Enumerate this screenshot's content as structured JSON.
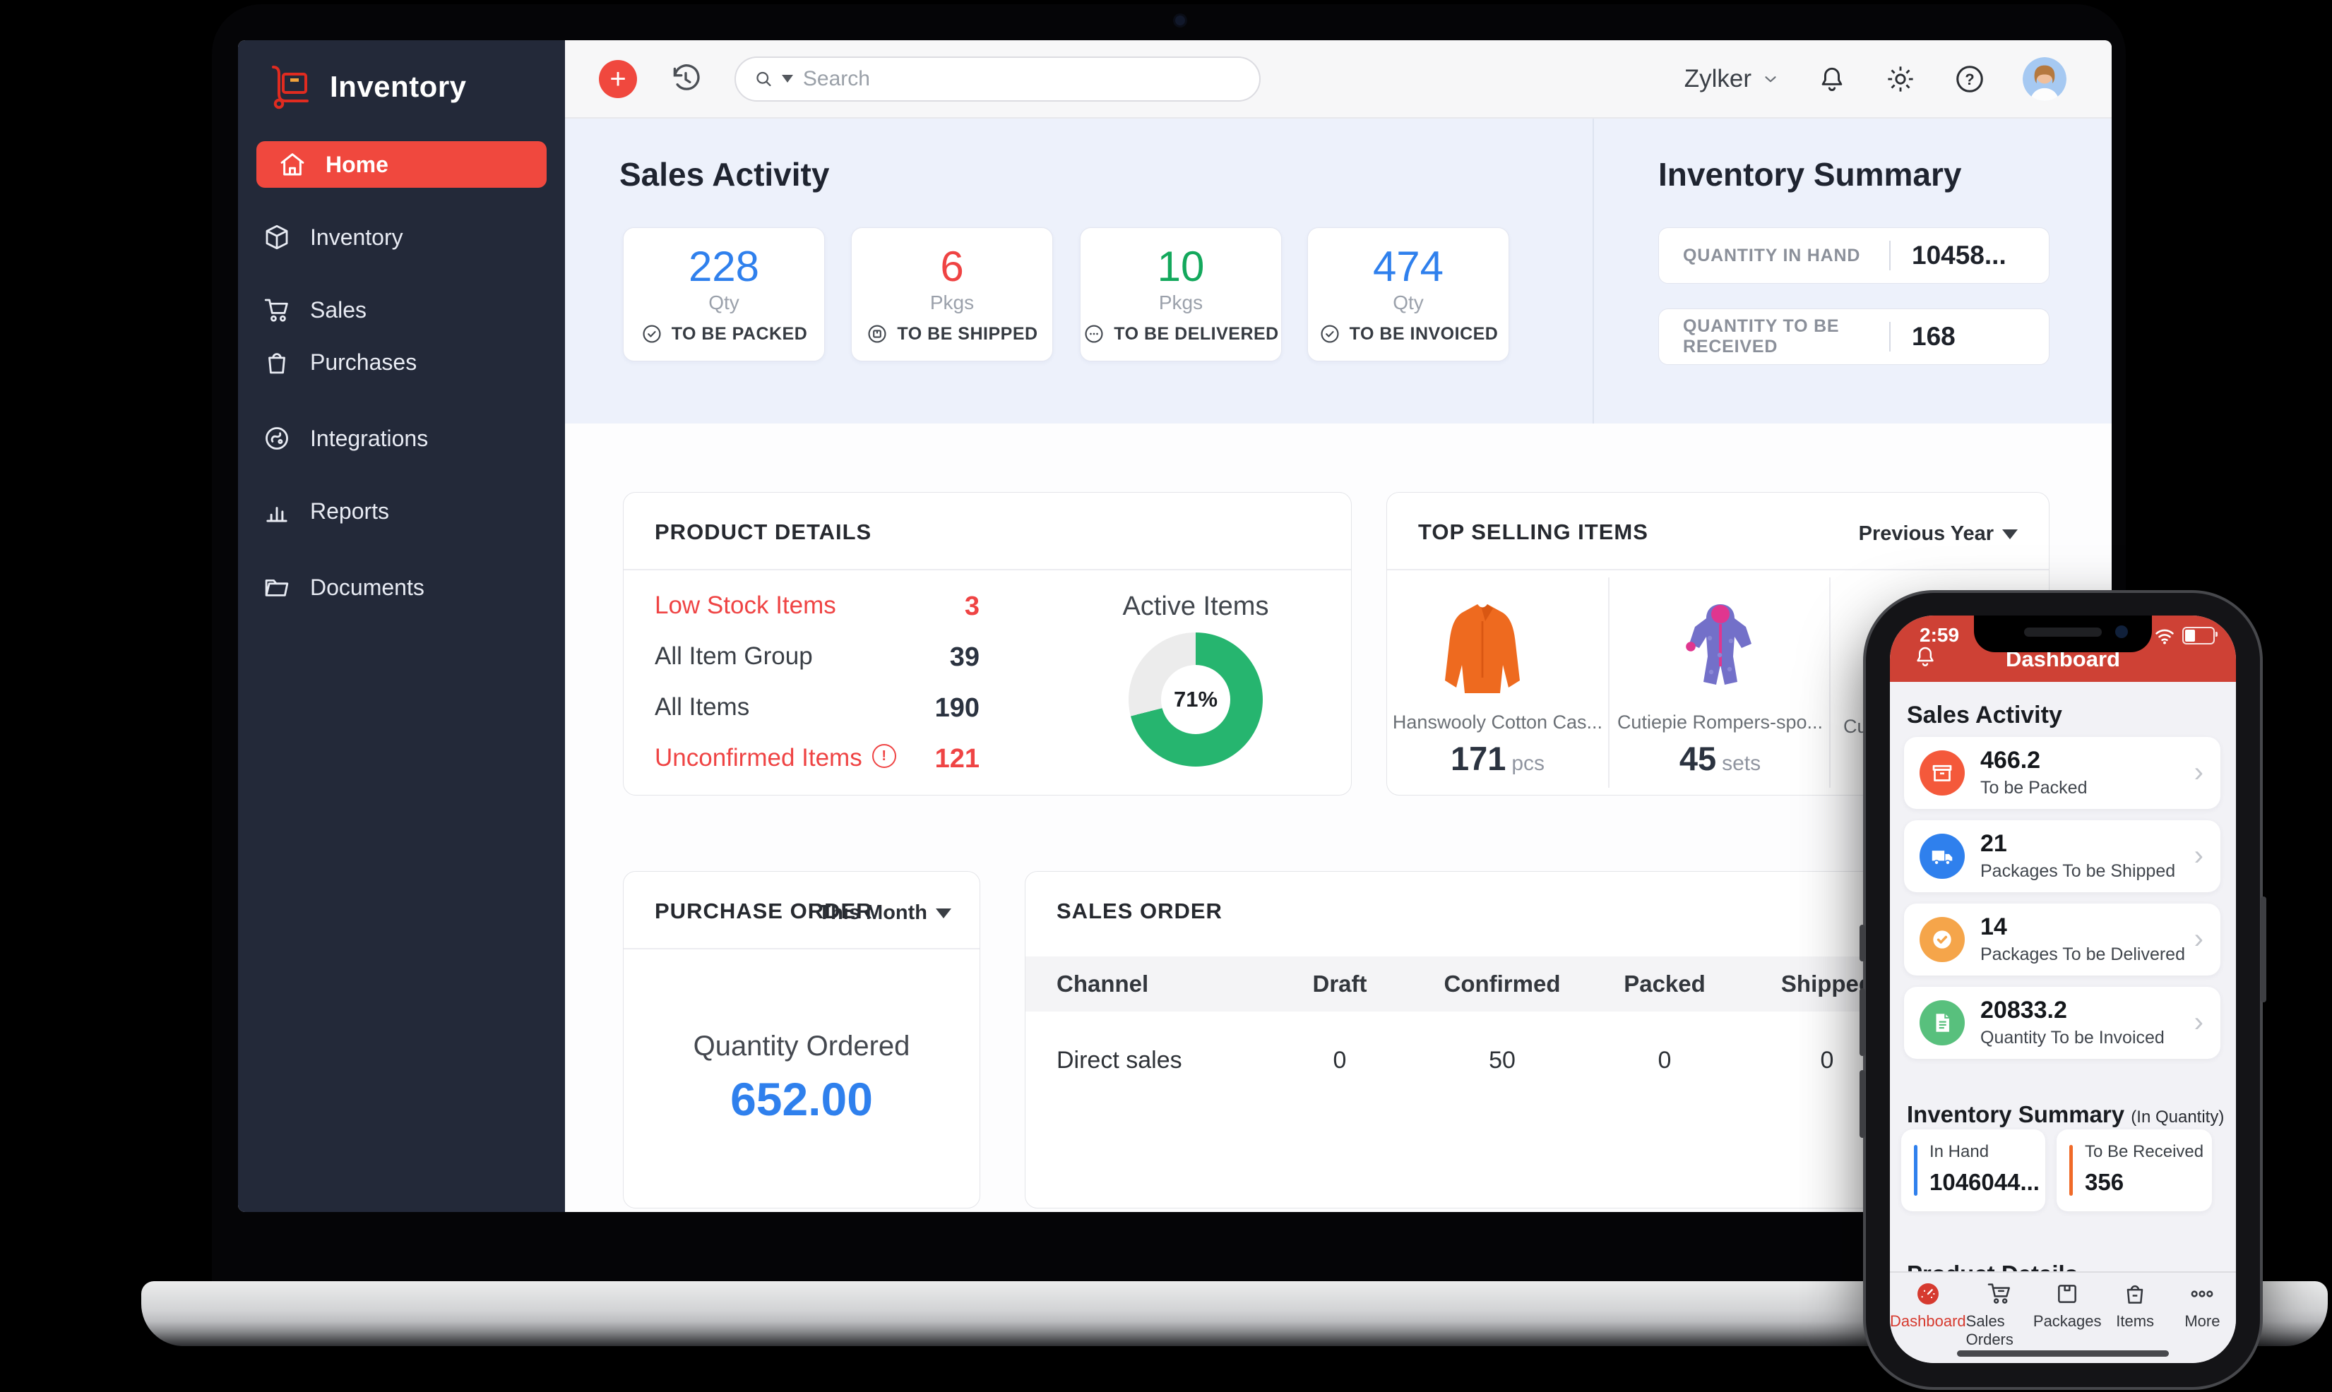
{
  "sidebar": {
    "app_title": "Inventory",
    "items": [
      {
        "label": "Home",
        "active": true,
        "has_submenu": false
      },
      {
        "label": "Inventory",
        "has_submenu": true
      },
      {
        "label": "Sales",
        "has_submenu": true
      },
      {
        "label": "Purchases",
        "has_submenu": true
      },
      {
        "label": "Integrations",
        "has_submenu": false
      },
      {
        "label": "Reports",
        "has_submenu": false
      },
      {
        "label": "Documents",
        "has_submenu": false
      }
    ],
    "bg_color": "#232939",
    "active_color": "#f0483e"
  },
  "topbar": {
    "search_placeholder": "Search",
    "org_name": "Zylker"
  },
  "hero": {
    "title": "Sales Activity",
    "cards": [
      {
        "value": "228",
        "unit": "Qty",
        "label": "TO BE PACKED",
        "color": "#2f80ed"
      },
      {
        "value": "6",
        "unit": "Pkgs",
        "label": "TO BE SHIPPED",
        "color": "#ef4343"
      },
      {
        "value": "10",
        "unit": "Pkgs",
        "label": "TO BE DELIVERED",
        "color": "#13a85c"
      },
      {
        "value": "474",
        "unit": "Qty",
        "label": "TO BE INVOICED",
        "color": "#2f80ed"
      }
    ],
    "summary": {
      "title": "Inventory Summary",
      "rows": [
        {
          "label": "QUANTITY IN HAND",
          "value": "10458..."
        },
        {
          "label": "QUANTITY TO BE RECEIVED",
          "value": "168"
        }
      ]
    }
  },
  "product_details": {
    "title": "PRODUCT DETAILS",
    "rows": [
      {
        "label": "Low Stock Items",
        "value": "3"
      },
      {
        "label": "All Item Group",
        "value": "39"
      },
      {
        "label": "All Items",
        "value": "190"
      },
      {
        "label": "Unconfirmed Items",
        "value": "121"
      }
    ],
    "donut": {
      "label": "Active Items",
      "percent": 71,
      "text": "71%",
      "color": "#26b56f",
      "track": "#ececec"
    }
  },
  "top_selling": {
    "title": "TOP SELLING ITEMS",
    "filter": "Previous Year",
    "items": [
      {
        "name": "Hanswooly Cotton Cas...",
        "qty": "171",
        "unit": "pcs"
      },
      {
        "name": "Cutiepie Rompers-spo...",
        "qty": "45",
        "unit": "sets"
      },
      {
        "name": "Cuti"
      }
    ]
  },
  "purchase_order": {
    "title": "PURCHASE ORDER",
    "filter": "This Month",
    "metric_label": "Quantity Ordered",
    "metric_value": "652.00",
    "value_color": "#2f80ed"
  },
  "sales_order": {
    "title": "SALES ORDER",
    "columns": [
      "Channel",
      "Draft",
      "Confirmed",
      "Packed",
      "Shipped"
    ],
    "rows": [
      {
        "channel": "Direct sales",
        "draft": "0",
        "confirmed": "50",
        "packed": "0",
        "shipped": "0"
      }
    ]
  },
  "phone": {
    "status_time": "2:59",
    "nav_title": "Dashboard",
    "sales_title": "Sales Activity",
    "activity": [
      {
        "value": "466.2",
        "label": "To be Packed",
        "color": "#f4593b"
      },
      {
        "value": "21",
        "label": "Packages To be Shipped",
        "color": "#2f80ed"
      },
      {
        "value": "14",
        "label": "Packages To be Delivered",
        "color": "#f5a54a"
      },
      {
        "value": "20833.2",
        "label": "Quantity To be Invoiced",
        "color": "#58c07d"
      }
    ],
    "inventory_title": "Inventory Summary",
    "inventory_subtitle": "(In Quantity)",
    "inventory_cards": [
      {
        "label": "In Hand",
        "value": "1046044...",
        "accent": "#2f80ed"
      },
      {
        "label": "To Be Received",
        "value": "356",
        "accent": "#f06a28"
      }
    ],
    "product_details_title": "Product Details",
    "bottom_nav": [
      {
        "label": "Dashboard",
        "active": true
      },
      {
        "label": "Sales Orders"
      },
      {
        "label": "Packages"
      },
      {
        "label": "Items"
      },
      {
        "label": "More"
      }
    ]
  }
}
